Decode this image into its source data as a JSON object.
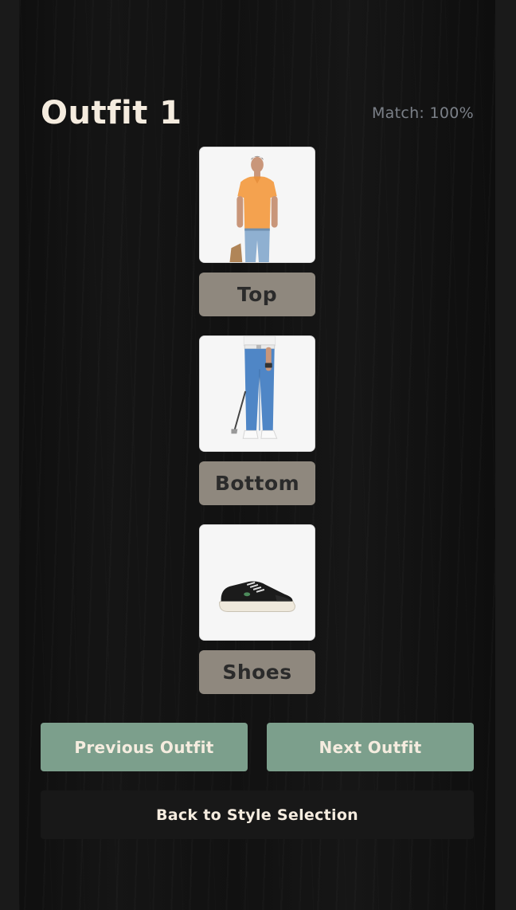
{
  "header": {
    "title": "Outfit 1",
    "match": "Match: 100%"
  },
  "items": [
    {
      "label": "Top",
      "image": "orange-polo-shirt-model-photo"
    },
    {
      "label": "Bottom",
      "image": "blue-chino-pants-golfer-photo"
    },
    {
      "label": "Shoes",
      "image": "black-canvas-sneaker-photo"
    }
  ],
  "nav": {
    "previous_label": "Previous Outfit",
    "next_label": "Next Outfit",
    "back_label": "Back to Style Selection"
  },
  "colors": {
    "background": "#141414",
    "title": "#f5ecdf",
    "match_text": "#7b8088",
    "item_label_bg": "#8f887e",
    "nav_button_bg": "#7c9f8c",
    "back_button_bg": "#181818"
  }
}
